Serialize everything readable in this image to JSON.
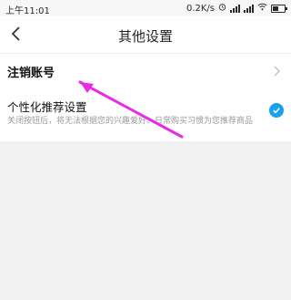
{
  "status_bar": {
    "time": "上午11:01",
    "speed": "0.2K/s",
    "icons": [
      "alarm-icon",
      "cellular-signal-icon",
      "cellular-signal-icon",
      "wifi-icon",
      "battery-icon"
    ]
  },
  "nav": {
    "title": "其他设置",
    "back_icon": "chevron-left-icon"
  },
  "settings": {
    "cancel_account": {
      "label": "注销账号",
      "icon": "chevron-right-icon"
    },
    "personalized": {
      "label": "个性化推荐设置",
      "description": "关闭按钮后，将无法根据您的兴趣爱好、日常购买习惯为您推荐商品",
      "checked": true,
      "check_color": "#1aa0f0"
    }
  },
  "annotation": {
    "arrow_color": "#e82ce6"
  }
}
